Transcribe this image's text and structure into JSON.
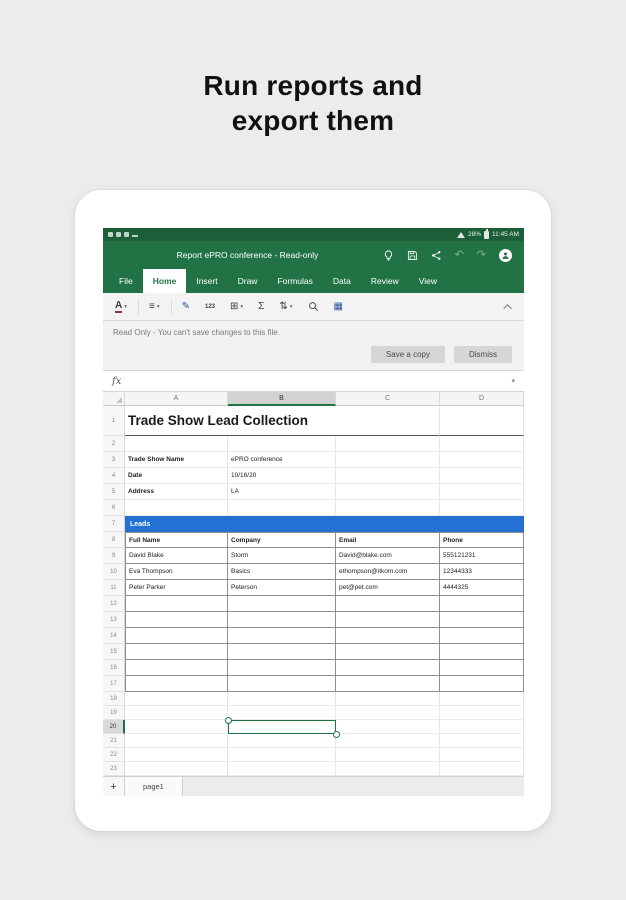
{
  "heading": {
    "line1": "Run reports and",
    "line2": "export them"
  },
  "status_bar": {
    "battery": "28%",
    "time": "11:45 AM"
  },
  "title_bar": {
    "document_title": "Report ePRO conference - Read-only"
  },
  "ribbon": {
    "tabs": [
      "File",
      "Home",
      "Insert",
      "Draw",
      "Formulas",
      "Data",
      "Review",
      "View"
    ],
    "active_tab": "Home"
  },
  "toolbar": {
    "icons": {
      "font_color": "A",
      "alignment": "≡",
      "format_painter": "✎",
      "number_format": "123",
      "borders": "⊞",
      "autosum": "Σ",
      "sort_filter": "⇅",
      "keyboard": "▦"
    }
  },
  "readonly_bar": {
    "message": "Read Only - You can't save changes to this file.",
    "save_copy_label": "Save a copy",
    "dismiss_label": "Dismiss"
  },
  "formula_bar": {
    "fx_label": "fx",
    "chevron": "▾"
  },
  "sheet": {
    "column_letters": [
      "A",
      "B",
      "C",
      "D"
    ],
    "selected_column": "B",
    "selected_cell": "B20",
    "row_numbers": [
      "1",
      "2",
      "3",
      "4",
      "5",
      "6",
      "7",
      "8",
      "9",
      "10",
      "11",
      "12",
      "13",
      "14",
      "15",
      "16",
      "17",
      "18",
      "19",
      "20",
      "21",
      "22",
      "23"
    ],
    "title": "Trade Show Lead Collection",
    "info_rows": [
      {
        "label": "Trade Show Name",
        "value": "ePRO conference"
      },
      {
        "label": "Date",
        "value": "10/16/20"
      },
      {
        "label": "Address",
        "value": "LA"
      }
    ],
    "leads_section_label": "Leads",
    "table": {
      "headers": [
        "Full Name",
        "Company",
        "Email",
        "Phone"
      ],
      "rows": [
        [
          "David Blake",
          "Storm",
          "David@blake.com",
          "555121231"
        ],
        [
          "Eva Thompson",
          "Basics",
          "ethompson@itkom.com",
          "12344333"
        ],
        [
          "Peter Parker",
          "Peterson",
          "pet@pet.com",
          "4444325"
        ]
      ]
    },
    "sheet_tab": "page1",
    "add_sheet_label": "+"
  },
  "colors": {
    "excel_green": "#217346",
    "status_bar_green": "#1b5e38",
    "leads_blue": "#2271d3",
    "selection_green": "#217346"
  }
}
